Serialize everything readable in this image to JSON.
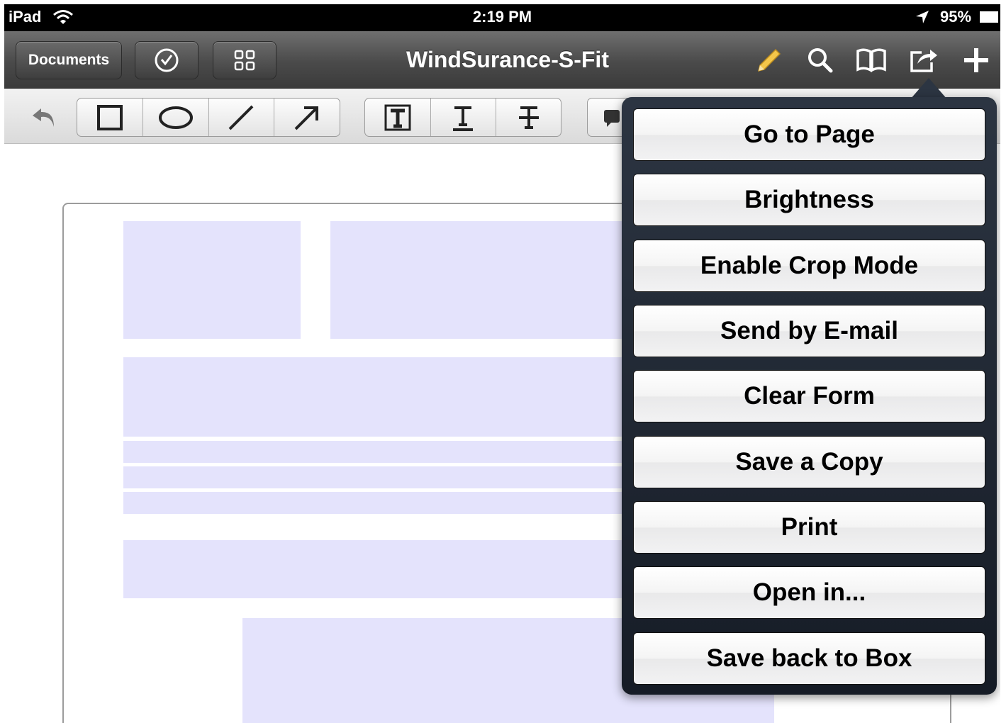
{
  "status_bar": {
    "device": "iPad",
    "time": "2:19 PM",
    "battery": "95%"
  },
  "nav": {
    "back_label": "Documents",
    "title": "WindSurance-S-Fit"
  },
  "menu": {
    "items": [
      "Go to Page",
      "Brightness",
      "Enable Crop Mode",
      "Send by E-mail",
      "Clear Form",
      "Save a Copy",
      "Print",
      "Open in...",
      "Save back to Box"
    ]
  },
  "colors": {
    "form_field": "#e4e3fc",
    "nav_bg": "#4a4a4a",
    "popover_bg": "#1f2631",
    "pencil": "#f4c64a"
  }
}
